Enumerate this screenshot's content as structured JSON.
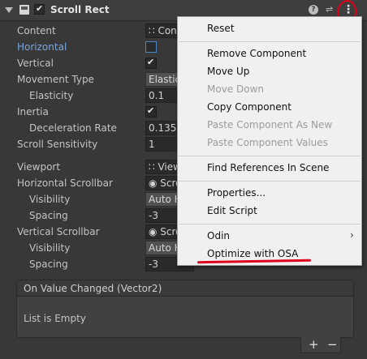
{
  "component": {
    "title": "Scroll Rect"
  },
  "properties": {
    "content": {
      "label": "Content",
      "value": "Con"
    },
    "horizontal": {
      "label": "Horizontal"
    },
    "vertical": {
      "label": "Vertical"
    },
    "movement_type": {
      "label": "Movement Type",
      "value": "Elastic"
    },
    "elasticity": {
      "label": "Elasticity",
      "value": "0.1"
    },
    "inertia": {
      "label": "Inertia"
    },
    "deceleration_rate": {
      "label": "Deceleration Rate",
      "value": "0.135"
    },
    "scroll_sensitivity": {
      "label": "Scroll Sensitivity",
      "value": "1"
    },
    "viewport": {
      "label": "Viewport",
      "value": "View"
    },
    "horizontal_scrollbar": {
      "label": "Horizontal Scrollbar",
      "value": "Scro"
    },
    "h_visibility": {
      "label": "Visibility",
      "value": "Auto H"
    },
    "h_spacing": {
      "label": "Spacing",
      "value": "-3"
    },
    "vertical_scrollbar": {
      "label": "Vertical Scrollbar",
      "value": "Scro"
    },
    "v_visibility": {
      "label": "Visibility",
      "value": "Auto H"
    },
    "v_spacing": {
      "label": "Spacing",
      "value": "-3"
    }
  },
  "event": {
    "title": "On Value Changed (Vector2)",
    "empty": "List is Empty",
    "add": "+",
    "remove": "−"
  },
  "menu": {
    "reset": "Reset",
    "remove_component": "Remove Component",
    "move_up": "Move Up",
    "move_down": "Move Down",
    "copy_component": "Copy Component",
    "paste_as_new": "Paste Component As New",
    "paste_values": "Paste Component Values",
    "find_references": "Find References In Scene",
    "properties": "Properties...",
    "edit_script": "Edit Script",
    "odin": "Odin",
    "optimize_osa": "Optimize with OSA"
  }
}
